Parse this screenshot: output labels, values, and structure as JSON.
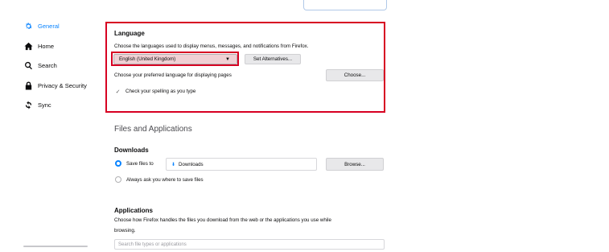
{
  "sidebar": {
    "items": [
      {
        "label": "General",
        "icon": "gear-icon",
        "selected": true
      },
      {
        "label": "Home",
        "icon": "home-icon",
        "selected": false
      },
      {
        "label": "Search",
        "icon": "search-icon",
        "selected": false
      },
      {
        "label": "Privacy & Security",
        "icon": "lock-icon",
        "selected": false
      },
      {
        "label": "Sync",
        "icon": "sync-icon",
        "selected": false
      }
    ]
  },
  "language": {
    "heading": "Language",
    "desc": "Choose the languages used to display menus, messages, and notifications from Firefox.",
    "selected_language": "English (United Kingdom)",
    "set_alternatives_label": "Set Alternatives...",
    "pages_desc": "Choose your preferred language for displaying pages",
    "choose_label": "Choose...",
    "spelling_label": "Check your spelling as you type",
    "spelling_checked": true
  },
  "files": {
    "section_title": "Files and Applications",
    "downloads_heading": "Downloads",
    "save_files_label": "Save files to",
    "download_folder": "Downloads",
    "browse_label": "Browse...",
    "always_ask_label": "Always ask you where to save files"
  },
  "applications": {
    "heading": "Applications",
    "desc_line1": "Choose how Firefox handles the files you download from the web or the applications you use while",
    "desc_line2": "browsing.",
    "search_placeholder": "Search file types or applications"
  },
  "colors": {
    "accent": "#0a84ff",
    "highlight_red": "#d70022"
  }
}
